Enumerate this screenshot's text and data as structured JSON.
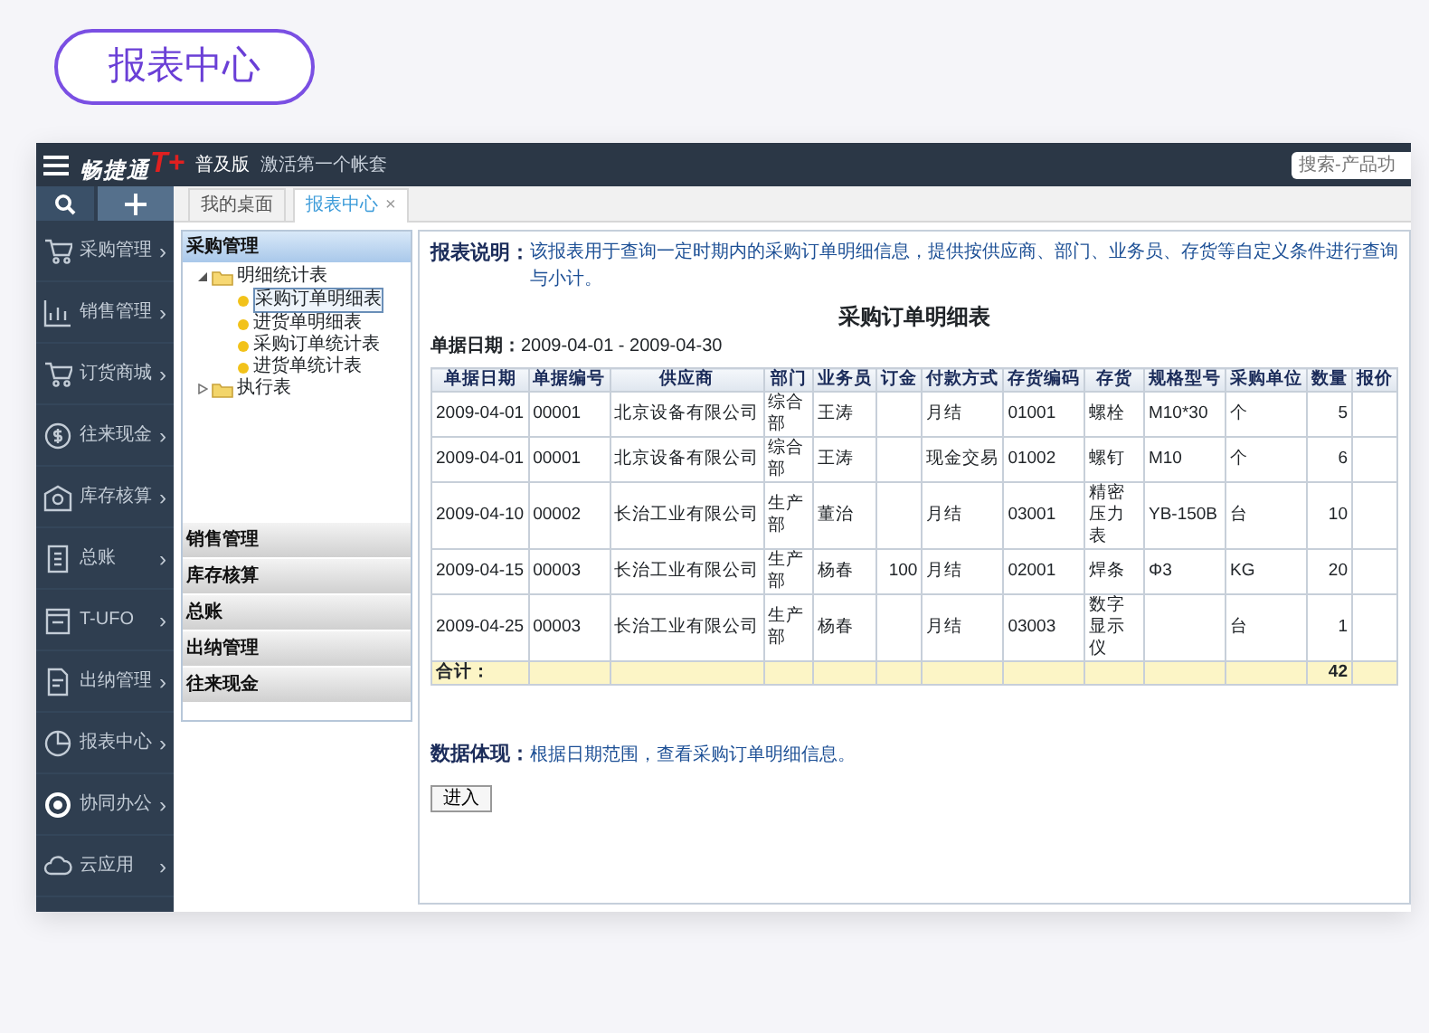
{
  "header_button": "报表中心",
  "app": {
    "logo": "畅捷通",
    "logo_mark": "T+",
    "edition": "普及版",
    "activate": "激活第一个帐套",
    "search": {
      "placeholder": "搜索-产品功"
    }
  },
  "sidebar": {
    "items": [
      {
        "label": "采购管理",
        "chevron": "›"
      },
      {
        "label": "销售管理",
        "chevron": "›"
      },
      {
        "label": "订货商城",
        "chevron": "›"
      },
      {
        "label": "往来现金",
        "chevron": "›"
      },
      {
        "label": "库存核算",
        "chevron": "›"
      },
      {
        "label": "总账",
        "chevron": "›"
      },
      {
        "label": "T-UFO",
        "chevron": "›"
      },
      {
        "label": "出纳管理",
        "chevron": "›"
      },
      {
        "label": "报表中心",
        "chevron": "›"
      },
      {
        "label": "协同办公",
        "chevron": "›"
      },
      {
        "label": "云应用",
        "chevron": "›"
      }
    ]
  },
  "tabs": [
    {
      "label": "我的桌面",
      "selected": false
    },
    {
      "label": "报表中心",
      "selected": true,
      "close": "×"
    }
  ],
  "tree": {
    "header": "采购管理",
    "nodes": [
      {
        "label": "明细统计表",
        "expanded": true,
        "children": [
          {
            "label": "采购订单明细表",
            "selected": true
          },
          {
            "label": "进货单明细表",
            "selected": false
          },
          {
            "label": "采购订单统计表",
            "selected": false
          },
          {
            "label": "进货单统计表",
            "selected": false
          }
        ]
      },
      {
        "label": "执行表",
        "expanded": false
      }
    ],
    "sections": [
      "销售管理",
      "库存核算",
      "总账",
      "出纳管理",
      "往来现金"
    ]
  },
  "report": {
    "note_label": "报表说明：",
    "note": "该报表用于查询一定时期内的采购订单明细信息，提供按供应商、部门、业务员、存货等自定义条件进行查询与小计。",
    "title": "采购订单明细表",
    "date_label": "单据日期：",
    "date_range": "2009-04-01 - 2009-04-30",
    "table": {
      "columns": [
        "单据日期",
        "单据编号",
        "供应商",
        "部门",
        "业务员",
        "订金",
        "付款方式",
        "存货编码",
        "存货",
        "规格型号",
        "采购单位",
        "数量",
        "报价"
      ],
      "rows": [
        {
          "date": "2009-04-01",
          "no": "00001",
          "supplier": "北京设备有限公司",
          "dept": "综合部",
          "clerk": "王涛",
          "payment": "月结",
          "code": "01001",
          "item": "螺栓",
          "spec": "M10*30",
          "unit": "个",
          "qty": "5"
        },
        {
          "date": "2009-04-01",
          "no": "00001",
          "supplier": "北京设备有限公司",
          "dept": "综合部",
          "clerk": "王涛",
          "payment": "现金交易",
          "code": "01002",
          "item": "螺钉",
          "spec": "M10",
          "unit": "个",
          "qty": "6"
        },
        {
          "date": "2009-04-10",
          "no": "00002",
          "supplier": "长治工业有限公司",
          "dept": "生产部",
          "clerk": "董治",
          "payment": "月结",
          "code": "03001",
          "item": "精密压力表",
          "spec": "YB-150B",
          "unit": "台",
          "qty": "10"
        },
        {
          "date": "2009-04-15",
          "no": "00003",
          "supplier": "长治工业有限公司",
          "dept": "生产部",
          "clerk": "杨春",
          "deposit": "100",
          "payment": "月结",
          "code": "02001",
          "item": "焊条",
          "spec": "Φ3",
          "unit": "KG",
          "qty": "20"
        },
        {
          "date": "2009-04-25",
          "no": "00003",
          "supplier": "长治工业有限公司",
          "dept": "生产部",
          "clerk": "杨春",
          "payment": "月结",
          "code": "03003",
          "item": "数字显示仪",
          "unit": "台",
          "qty": "1"
        }
      ],
      "total": {
        "label": "合计：",
        "qty": "42"
      }
    },
    "data_label": "数据体现：",
    "data_note": "根据日期范围，查看采购订单明细信息。",
    "button": "进入"
  }
}
